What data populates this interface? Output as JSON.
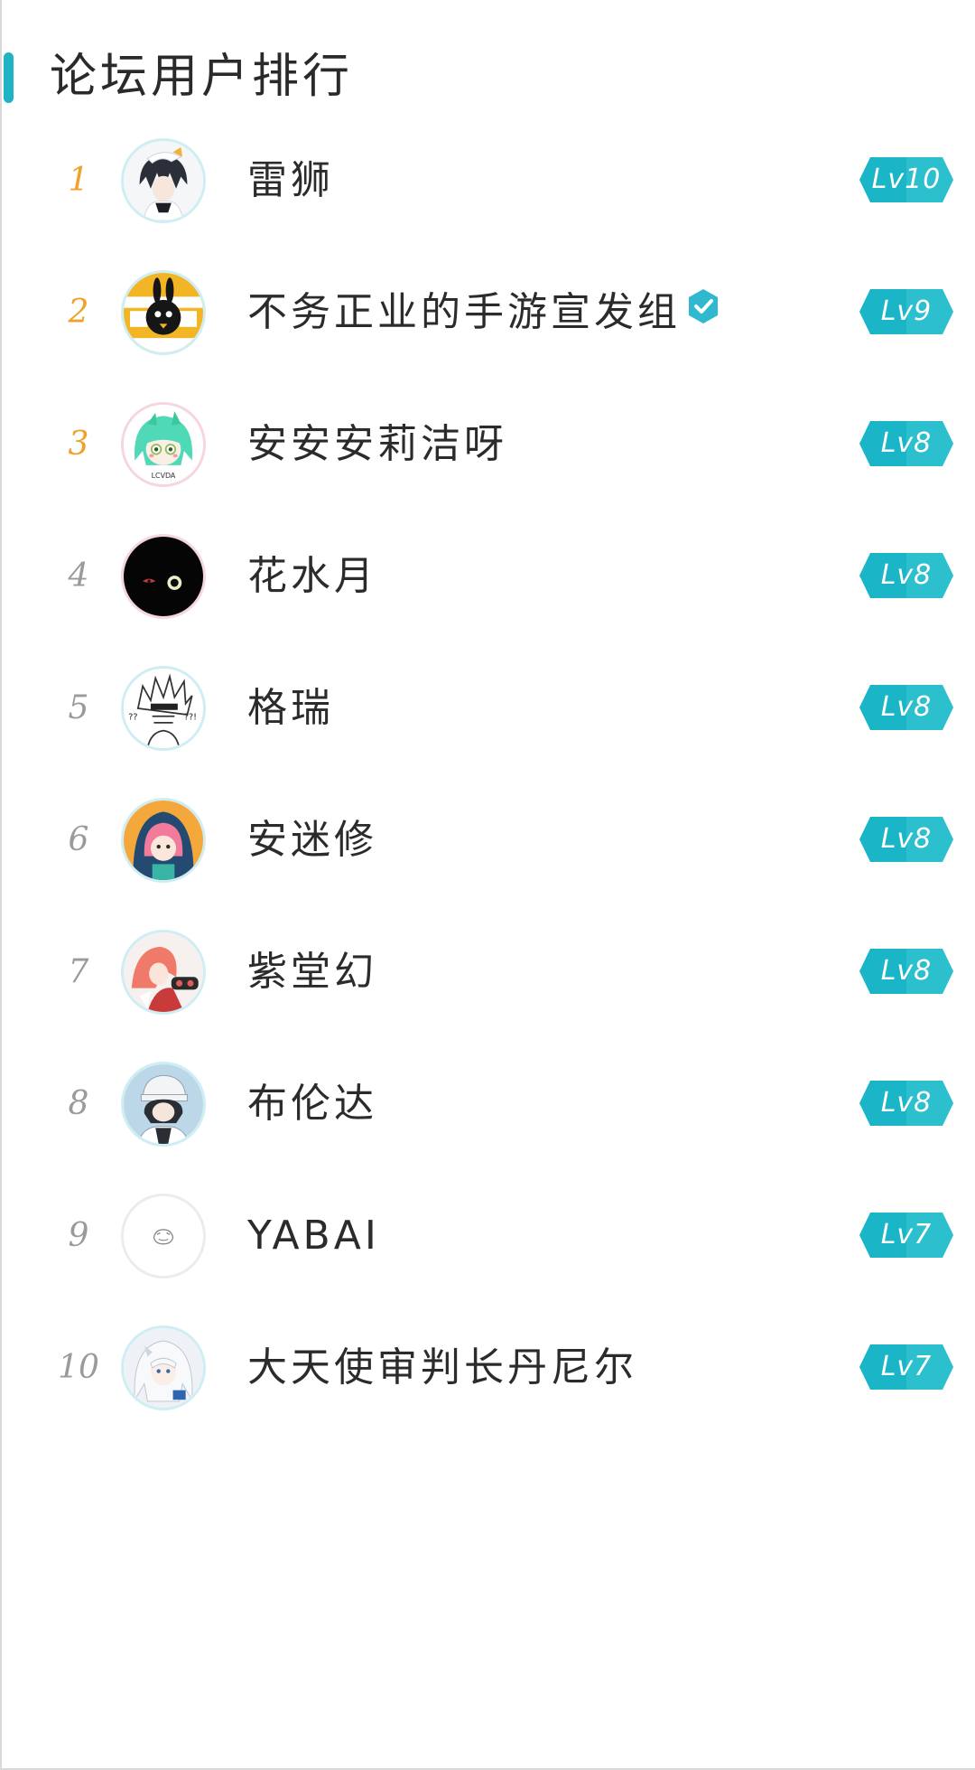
{
  "header": {
    "title": "论坛用户排行"
  },
  "colors": {
    "accent": "#1fb3c4",
    "top_rank": "#f0a12a",
    "rank": "#9a9a9a",
    "level_badge": "#1ab5c6"
  },
  "users": [
    {
      "rank": "1",
      "name": "雷狮",
      "level": "Lv10",
      "verified": false,
      "avatar_icon": "avatar-anime-boy-white-hair"
    },
    {
      "rank": "2",
      "name": "不务正业的手游宣发组",
      "level": "Lv9",
      "verified": true,
      "avatar_icon": "avatar-black-bunny-orange"
    },
    {
      "rank": "3",
      "name": "安安安莉洁呀",
      "level": "Lv8",
      "verified": false,
      "avatar_icon": "avatar-green-hair-girl"
    },
    {
      "rank": "4",
      "name": "花水月",
      "level": "Lv8",
      "verified": false,
      "avatar_icon": "avatar-dark-eyes"
    },
    {
      "rank": "5",
      "name": "格瑞",
      "level": "Lv8",
      "verified": false,
      "avatar_icon": "avatar-sketch-spiky-hair"
    },
    {
      "rank": "6",
      "name": "安迷修",
      "level": "Lv8",
      "verified": false,
      "avatar_icon": "avatar-pink-hair-hood"
    },
    {
      "rank": "7",
      "name": "紫堂幻",
      "level": "Lv8",
      "verified": false,
      "avatar_icon": "avatar-red-hair-character"
    },
    {
      "rank": "8",
      "name": "布伦达",
      "level": "Lv8",
      "verified": false,
      "avatar_icon": "avatar-cap-boy-blue"
    },
    {
      "rank": "9",
      "name": "YABAI",
      "level": "Lv7",
      "verified": false,
      "avatar_icon": "avatar-small-doodle"
    },
    {
      "rank": "10",
      "name": "大天使审判长丹尼尔",
      "level": "Lv7",
      "verified": false,
      "avatar_icon": "avatar-white-hair-angel"
    }
  ]
}
